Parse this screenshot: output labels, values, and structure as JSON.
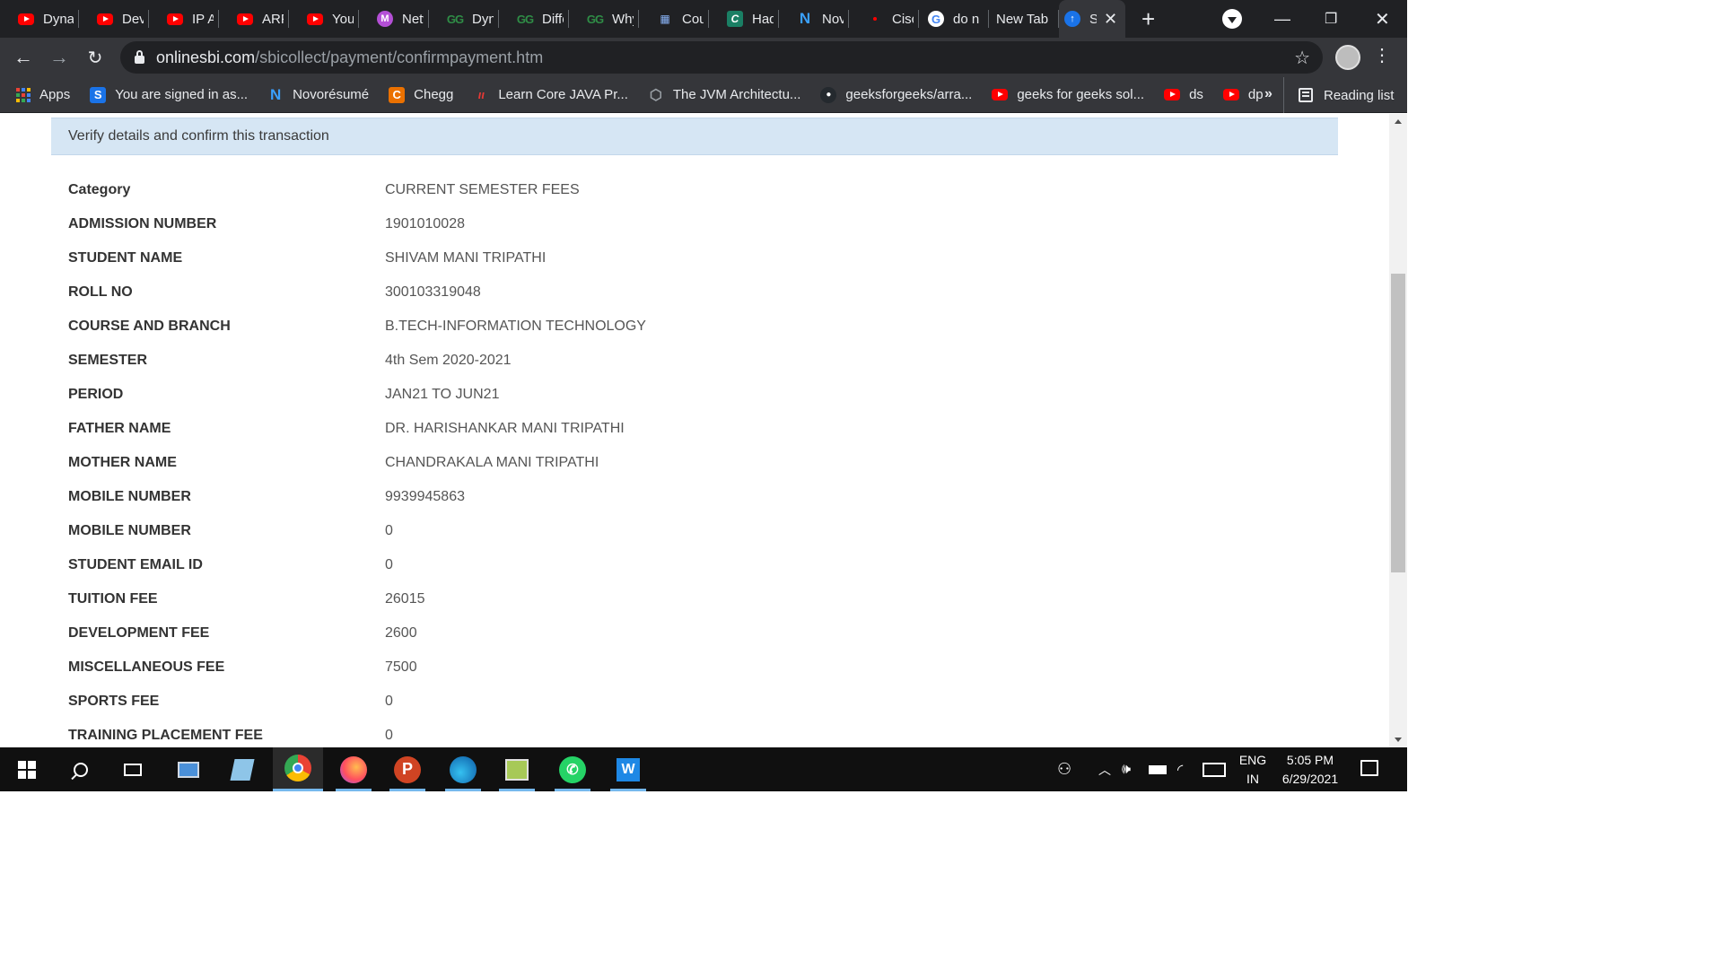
{
  "browser": {
    "tabs": [
      {
        "title": "Dyna",
        "icon": "youtube-icon"
      },
      {
        "title": "DevC",
        "icon": "youtube-icon"
      },
      {
        "title": "IP Ac",
        "icon": "youtube-icon"
      },
      {
        "title": "ARP",
        "icon": "youtube-icon"
      },
      {
        "title": "YouT",
        "icon": "youtube-icon"
      },
      {
        "title": "Netw",
        "icon": "m-icon"
      },
      {
        "title": "Dyna",
        "icon": "geeksforgeeks-icon"
      },
      {
        "title": "Diffe",
        "icon": "geeksforgeeks-icon"
      },
      {
        "title": "Why",
        "icon": "geeksforgeeks-icon"
      },
      {
        "title": "Cour",
        "icon": "coursera-icon"
      },
      {
        "title": "Hadc",
        "icon": "c-icon"
      },
      {
        "title": "Nov",
        "icon": "novoresume-icon"
      },
      {
        "title": "Cisco",
        "icon": "youtube-icon"
      },
      {
        "title": "do n",
        "icon": "google-icon"
      },
      {
        "title": "New Tab",
        "icon": "none"
      },
      {
        "title": "S",
        "icon": "sbi-icon",
        "active": true
      }
    ],
    "url_host": "onlinesbi.com",
    "url_path": "/sbicollect/payment/confirmpayment.htm",
    "bookmarks": [
      {
        "label": "Apps",
        "icon": "apps-grid-icon"
      },
      {
        "label": "You are signed in as...",
        "icon": "s-icon"
      },
      {
        "label": "Novorésumé",
        "icon": "novoresume-icon"
      },
      {
        "label": "Chegg",
        "icon": "chegg-icon"
      },
      {
        "label": "Learn Core JAVA Pr...",
        "icon": "learn-icon"
      },
      {
        "label": "The JVM Architectu...",
        "icon": "globe-icon"
      },
      {
        "label": "geeksforgeeks/arra...",
        "icon": "github-icon"
      },
      {
        "label": "geeks for geeks sol...",
        "icon": "youtube-icon"
      },
      {
        "label": "ds",
        "icon": "youtube-icon"
      },
      {
        "label": "dp",
        "icon": "youtube-icon"
      }
    ],
    "more_bookmarks": "»",
    "reading_list": "Reading list"
  },
  "page": {
    "banner": "Verify details and confirm this transaction",
    "rows": [
      {
        "label": "Category",
        "value": "CURRENT SEMESTER FEES"
      },
      {
        "label": "ADMISSION NUMBER",
        "value": "1901010028"
      },
      {
        "label": "STUDENT NAME",
        "value": "SHIVAM MANI TRIPATHI"
      },
      {
        "label": "ROLL NO",
        "value": "300103319048"
      },
      {
        "label": "COURSE AND BRANCH",
        "value": "B.TECH-INFORMATION TECHNOLOGY"
      },
      {
        "label": "SEMESTER",
        "value": "4th Sem 2020-2021"
      },
      {
        "label": "PERIOD",
        "value": "JAN21 TO JUN21"
      },
      {
        "label": "FATHER NAME",
        "value": "DR. HARISHANKAR MANI TRIPATHI"
      },
      {
        "label": "MOTHER NAME",
        "value": "CHANDRAKALA MANI TRIPATHI"
      },
      {
        "label": "MOBILE NUMBER",
        "value": "9939945863"
      },
      {
        "label": "MOBILE NUMBER",
        "value": "0"
      },
      {
        "label": "STUDENT EMAIL ID",
        "value": "0"
      },
      {
        "label": "TUITION FEE",
        "value": "26015"
      },
      {
        "label": "DEVELOPMENT FEE",
        "value": "2600"
      },
      {
        "label": "MISCELLANEOUS FEE",
        "value": "7500"
      },
      {
        "label": "SPORTS FEE",
        "value": "0"
      },
      {
        "label": "TRAINING PLACEMENT FEE",
        "value": "0"
      }
    ]
  },
  "taskbar": {
    "apps": [
      "windows-start",
      "search",
      "task-view",
      "file-explorer",
      "notepad",
      "chrome",
      "firefox",
      "powerpoint",
      "edge",
      "screenshot-tool",
      "whatsapp",
      "word"
    ],
    "lang_line1": "ENG",
    "lang_line2": "IN",
    "time": "5:05 PM",
    "date": "6/29/2021"
  },
  "colors": {
    "banner_bg": "#d6e6f4",
    "chrome_dark": "#202124",
    "chrome_toolbar": "#35363a",
    "taskbar": "#101010",
    "accent": "#76b9ed"
  }
}
